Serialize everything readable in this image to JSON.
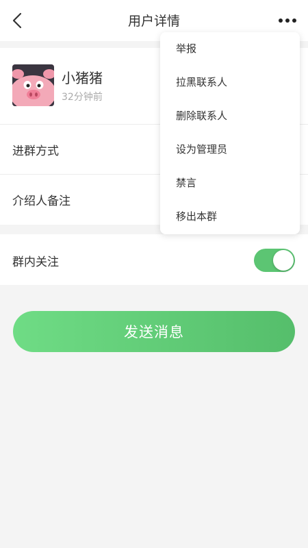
{
  "nav": {
    "title": "用户详情",
    "back_icon": "chevron-left-icon",
    "more_icon": "more-horizontal-icon"
  },
  "profile": {
    "nickname": "小猪猪",
    "last_seen": "32分钟前",
    "avatar_icon": "pig-avatar"
  },
  "rows": {
    "join_method": "进群方式",
    "referrer_note": "介绍人备注"
  },
  "follow": {
    "label": "群内关注",
    "enabled": true
  },
  "send_button": {
    "label": "发送消息"
  },
  "menu": {
    "items": [
      {
        "label": "举报"
      },
      {
        "label": "拉黑联系人"
      },
      {
        "label": "删除联系人"
      },
      {
        "label": "设为管理员"
      },
      {
        "label": "禁言"
      },
      {
        "label": "移出本群"
      }
    ]
  },
  "colors": {
    "accent_green": "#5cc573",
    "button_gradient_start": "#6fdc85",
    "button_gradient_end": "#55be6b",
    "background": "#f4f4f4"
  }
}
